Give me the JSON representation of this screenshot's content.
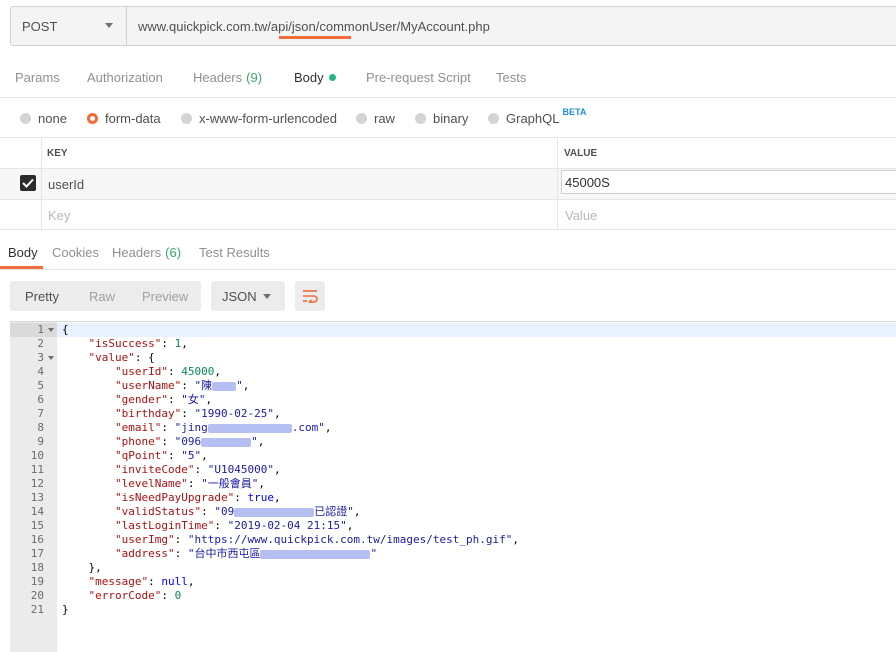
{
  "request": {
    "method": "POST",
    "url": "www.quickpick.com.tw/api/json/commonUser/MyAccount.php"
  },
  "request_tabs": [
    {
      "label": "Params",
      "count": ""
    },
    {
      "label": "Authorization",
      "count": ""
    },
    {
      "label": "Headers",
      "count": "(9)"
    },
    {
      "label": "Body",
      "count": ""
    },
    {
      "label": "Pre-request Script",
      "count": ""
    },
    {
      "label": "Tests",
      "count": ""
    }
  ],
  "body_types": {
    "none": "none",
    "form_data": "form-data",
    "urlencoded": "x-www-form-urlencoded",
    "raw": "raw",
    "binary": "binary",
    "graphql": "GraphQL",
    "beta_badge": "BETA"
  },
  "kv_table": {
    "key_header": "KEY",
    "value_header": "VALUE",
    "rows": [
      {
        "key": "userId",
        "value": "45000S",
        "checked": true
      }
    ],
    "key_placeholder": "Key",
    "value_placeholder": "Value"
  },
  "response_tabs": [
    {
      "label": "Body",
      "count": ""
    },
    {
      "label": "Cookies",
      "count": ""
    },
    {
      "label": "Headers",
      "count": "(6)"
    },
    {
      "label": "Test Results",
      "count": ""
    }
  ],
  "view_modes": {
    "pretty": "Pretty",
    "raw": "Raw",
    "preview": "Preview",
    "format": "JSON"
  },
  "code": {
    "line_numbers": [
      "1",
      "2",
      "3",
      "4",
      "5",
      "6",
      "7",
      "8",
      "9",
      "10",
      "11",
      "12",
      "13",
      "14",
      "15",
      "16",
      "17",
      "18",
      "19",
      "20",
      "21"
    ],
    "open_brace": "{",
    "close_brace": "}",
    "isSuccess_key": "\"isSuccess\"",
    "isSuccess_val": "1",
    "value_key": "\"value\"",
    "value_close": "},",
    "userId_key": "\"userId\"",
    "userId_val": "45000",
    "userName_key": "\"userName\"",
    "userName_val": "\"陳",
    "gender_key": "\"gender\"",
    "gender_val": "\"女\"",
    "birthday_key": "\"birthday\"",
    "birthday_val": "\"1990-02-25\"",
    "email_key": "\"email\"",
    "email_val": "\"jing",
    "email_tail": ".com\"",
    "phone_key": "\"phone\"",
    "phone_val": "\"096",
    "qPoint_key": "\"qPoint\"",
    "qPoint_val": "\"5\"",
    "inviteCode_key": "\"inviteCode\"",
    "inviteCode_val": "\"U1045000\"",
    "levelName_key": "\"levelName\"",
    "levelName_val": "\"一般會員\"",
    "isNeedPayUpgrade_key": "\"isNeedPayUpgrade\"",
    "isNeedPayUpgrade_val": "true",
    "validStatus_key": "\"validStatus\"",
    "validStatus_val": "\"09",
    "validStatus_tail": "已認證\"",
    "lastLoginTime_key": "\"lastLoginTime\"",
    "lastLoginTime_val": "\"2019-02-04 21:15\"",
    "userImg_key": "\"userImg\"",
    "userImg_val": "\"https://www.quickpick.com.tw/images/test_ph.gif\"",
    "address_key": "\"address\"",
    "address_val": "\"台中市西屯區",
    "message_key": "\"message\"",
    "message_val": "null",
    "errorCode_key": "\"errorCode\"",
    "errorCode_val": "0"
  },
  "colors": {
    "accent": "#f26b3a",
    "green_dot": "#26b47f",
    "count_green": "#3fa36c",
    "beta_blue": "#1f8fd8"
  },
  "icons": {
    "method_caret": "chevron-down-icon",
    "format_caret": "chevron-down-icon",
    "wrap": "wrap-lines-icon",
    "checkbox": "checkmark-icon"
  }
}
